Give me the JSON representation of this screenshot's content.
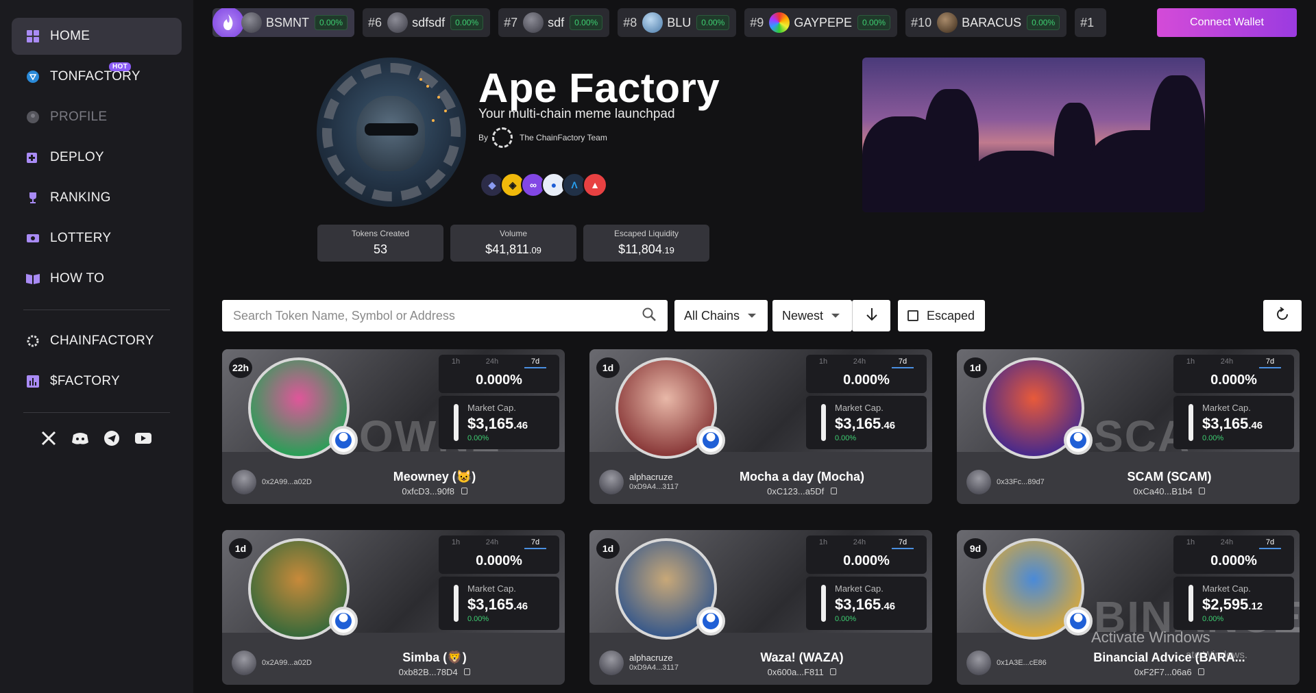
{
  "sidebar": {
    "items": [
      {
        "label": "HOME",
        "icon": "grid-icon"
      },
      {
        "label": "TONFACTORY",
        "icon": "ton-icon",
        "badge": "HOT"
      },
      {
        "label": "PROFILE",
        "icon": "user-icon"
      },
      {
        "label": "DEPLOY",
        "icon": "plus-square-icon"
      },
      {
        "label": "RANKING",
        "icon": "trophy-icon"
      },
      {
        "label": "LOTTERY",
        "icon": "ticket-icon"
      },
      {
        "label": "HOW TO",
        "icon": "book-icon"
      },
      {
        "label": "CHAINFACTORY",
        "icon": "chain-icon"
      },
      {
        "label": "$FACTORY",
        "icon": "chart-icon"
      }
    ]
  },
  "ticker": [
    {
      "rank": "",
      "name": "BSMNT",
      "pct": "0.00%"
    },
    {
      "rank": "#6",
      "name": "sdfsdf",
      "pct": "0.00%"
    },
    {
      "rank": "#7",
      "name": "sdf",
      "pct": "0.00%"
    },
    {
      "rank": "#8",
      "name": "BLU",
      "pct": "0.00%"
    },
    {
      "rank": "#9",
      "name": "GAYPEPE",
      "pct": "0.00%"
    },
    {
      "rank": "#10",
      "name": "BARACUS",
      "pct": "0.00%"
    },
    {
      "rank": "#1",
      "name": "",
      "pct": ""
    }
  ],
  "connect_label": "Connect Wallet",
  "hero": {
    "title": "Ape Factory",
    "subtitle": "Your multi-chain meme launchpad",
    "by": "By",
    "team": "The ChainFactory Team",
    "chains": [
      "ethereum",
      "bnb",
      "polygon",
      "base",
      "arbitrum",
      "avalanche"
    ]
  },
  "stats": [
    {
      "label": "Tokens Created",
      "value": "53"
    },
    {
      "label": "Volume",
      "value": "$41,811",
      "cents": ".09"
    },
    {
      "label": "Escaped Liquidity",
      "value": "$11,804",
      "cents": ".19"
    }
  ],
  "filters": {
    "search_placeholder": "Search Token Name, Symbol or Address",
    "chain": "All Chains",
    "sort": "Newest",
    "escaped": "Escaped"
  },
  "card_tabs": [
    "1h",
    "24h",
    "7d"
  ],
  "mcap_label": "Market Cap.",
  "cards": [
    {
      "age": "22h",
      "bgtext": "OWNE",
      "perf": "0.000%",
      "mcap": "$3,165",
      "mcap_cents": ".46",
      "chg": "0.00%",
      "creator_name": "",
      "creator_addr": "0x2A99...a02D",
      "name": "Meowney (😺)",
      "addr": "0xfcD3...90f8",
      "colors": [
        "#e0569a",
        "#2c9e58"
      ]
    },
    {
      "age": "1d",
      "bgtext": "",
      "perf": "0.000%",
      "mcap": "$3,165",
      "mcap_cents": ".46",
      "chg": "0.00%",
      "creator_name": "alphacruze",
      "creator_addr": "0xD9A4...3117",
      "name": "Mocha a day (Mocha)",
      "addr": "0xC123...a5Df",
      "colors": [
        "#e8b8a8",
        "#8a3a3a"
      ]
    },
    {
      "age": "1d",
      "bgtext": "SCA",
      "perf": "0.000%",
      "mcap": "$3,165",
      "mcap_cents": ".46",
      "chg": "0.00%",
      "creator_name": "",
      "creator_addr": "0x33Fc...89d7",
      "name": "SCAM (SCAM)",
      "addr": "0xCa40...B1b4",
      "colors": [
        "#e85a3a",
        "#4a2a8a"
      ]
    },
    {
      "age": "1d",
      "bgtext": "",
      "perf": "0.000%",
      "mcap": "$3,165",
      "mcap_cents": ".46",
      "chg": "0.00%",
      "creator_name": "",
      "creator_addr": "0x2A99...a02D",
      "name": "Simba (🦁)",
      "addr": "0xb82B...78D4",
      "colors": [
        "#c88a3a",
        "#3a6a3a"
      ]
    },
    {
      "age": "1d",
      "bgtext": "",
      "perf": "0.000%",
      "mcap": "$3,165",
      "mcap_cents": ".46",
      "chg": "0.00%",
      "creator_name": "alphacruze",
      "creator_addr": "0xD9A4...3117",
      "name": "Waza! (WAZA)",
      "addr": "0x600a...F811",
      "colors": [
        "#c8a878",
        "#3a5a8a"
      ]
    },
    {
      "age": "9d",
      "bgtext": "BINANCE",
      "perf": "0.000%",
      "mcap": "$2,595",
      "mcap_cents": ".12",
      "chg": "0.00%",
      "creator_name": "",
      "creator_addr": "0x1A3E...cE86",
      "name": "Binancial Advice (BARA...",
      "addr": "0xF2F7...06a6",
      "colors": [
        "#4a8ad8",
        "#d8a83a"
      ]
    }
  ],
  "watermark": {
    "title": "Activate Windows",
    "sub": "Go to Settings to activate Windows."
  }
}
